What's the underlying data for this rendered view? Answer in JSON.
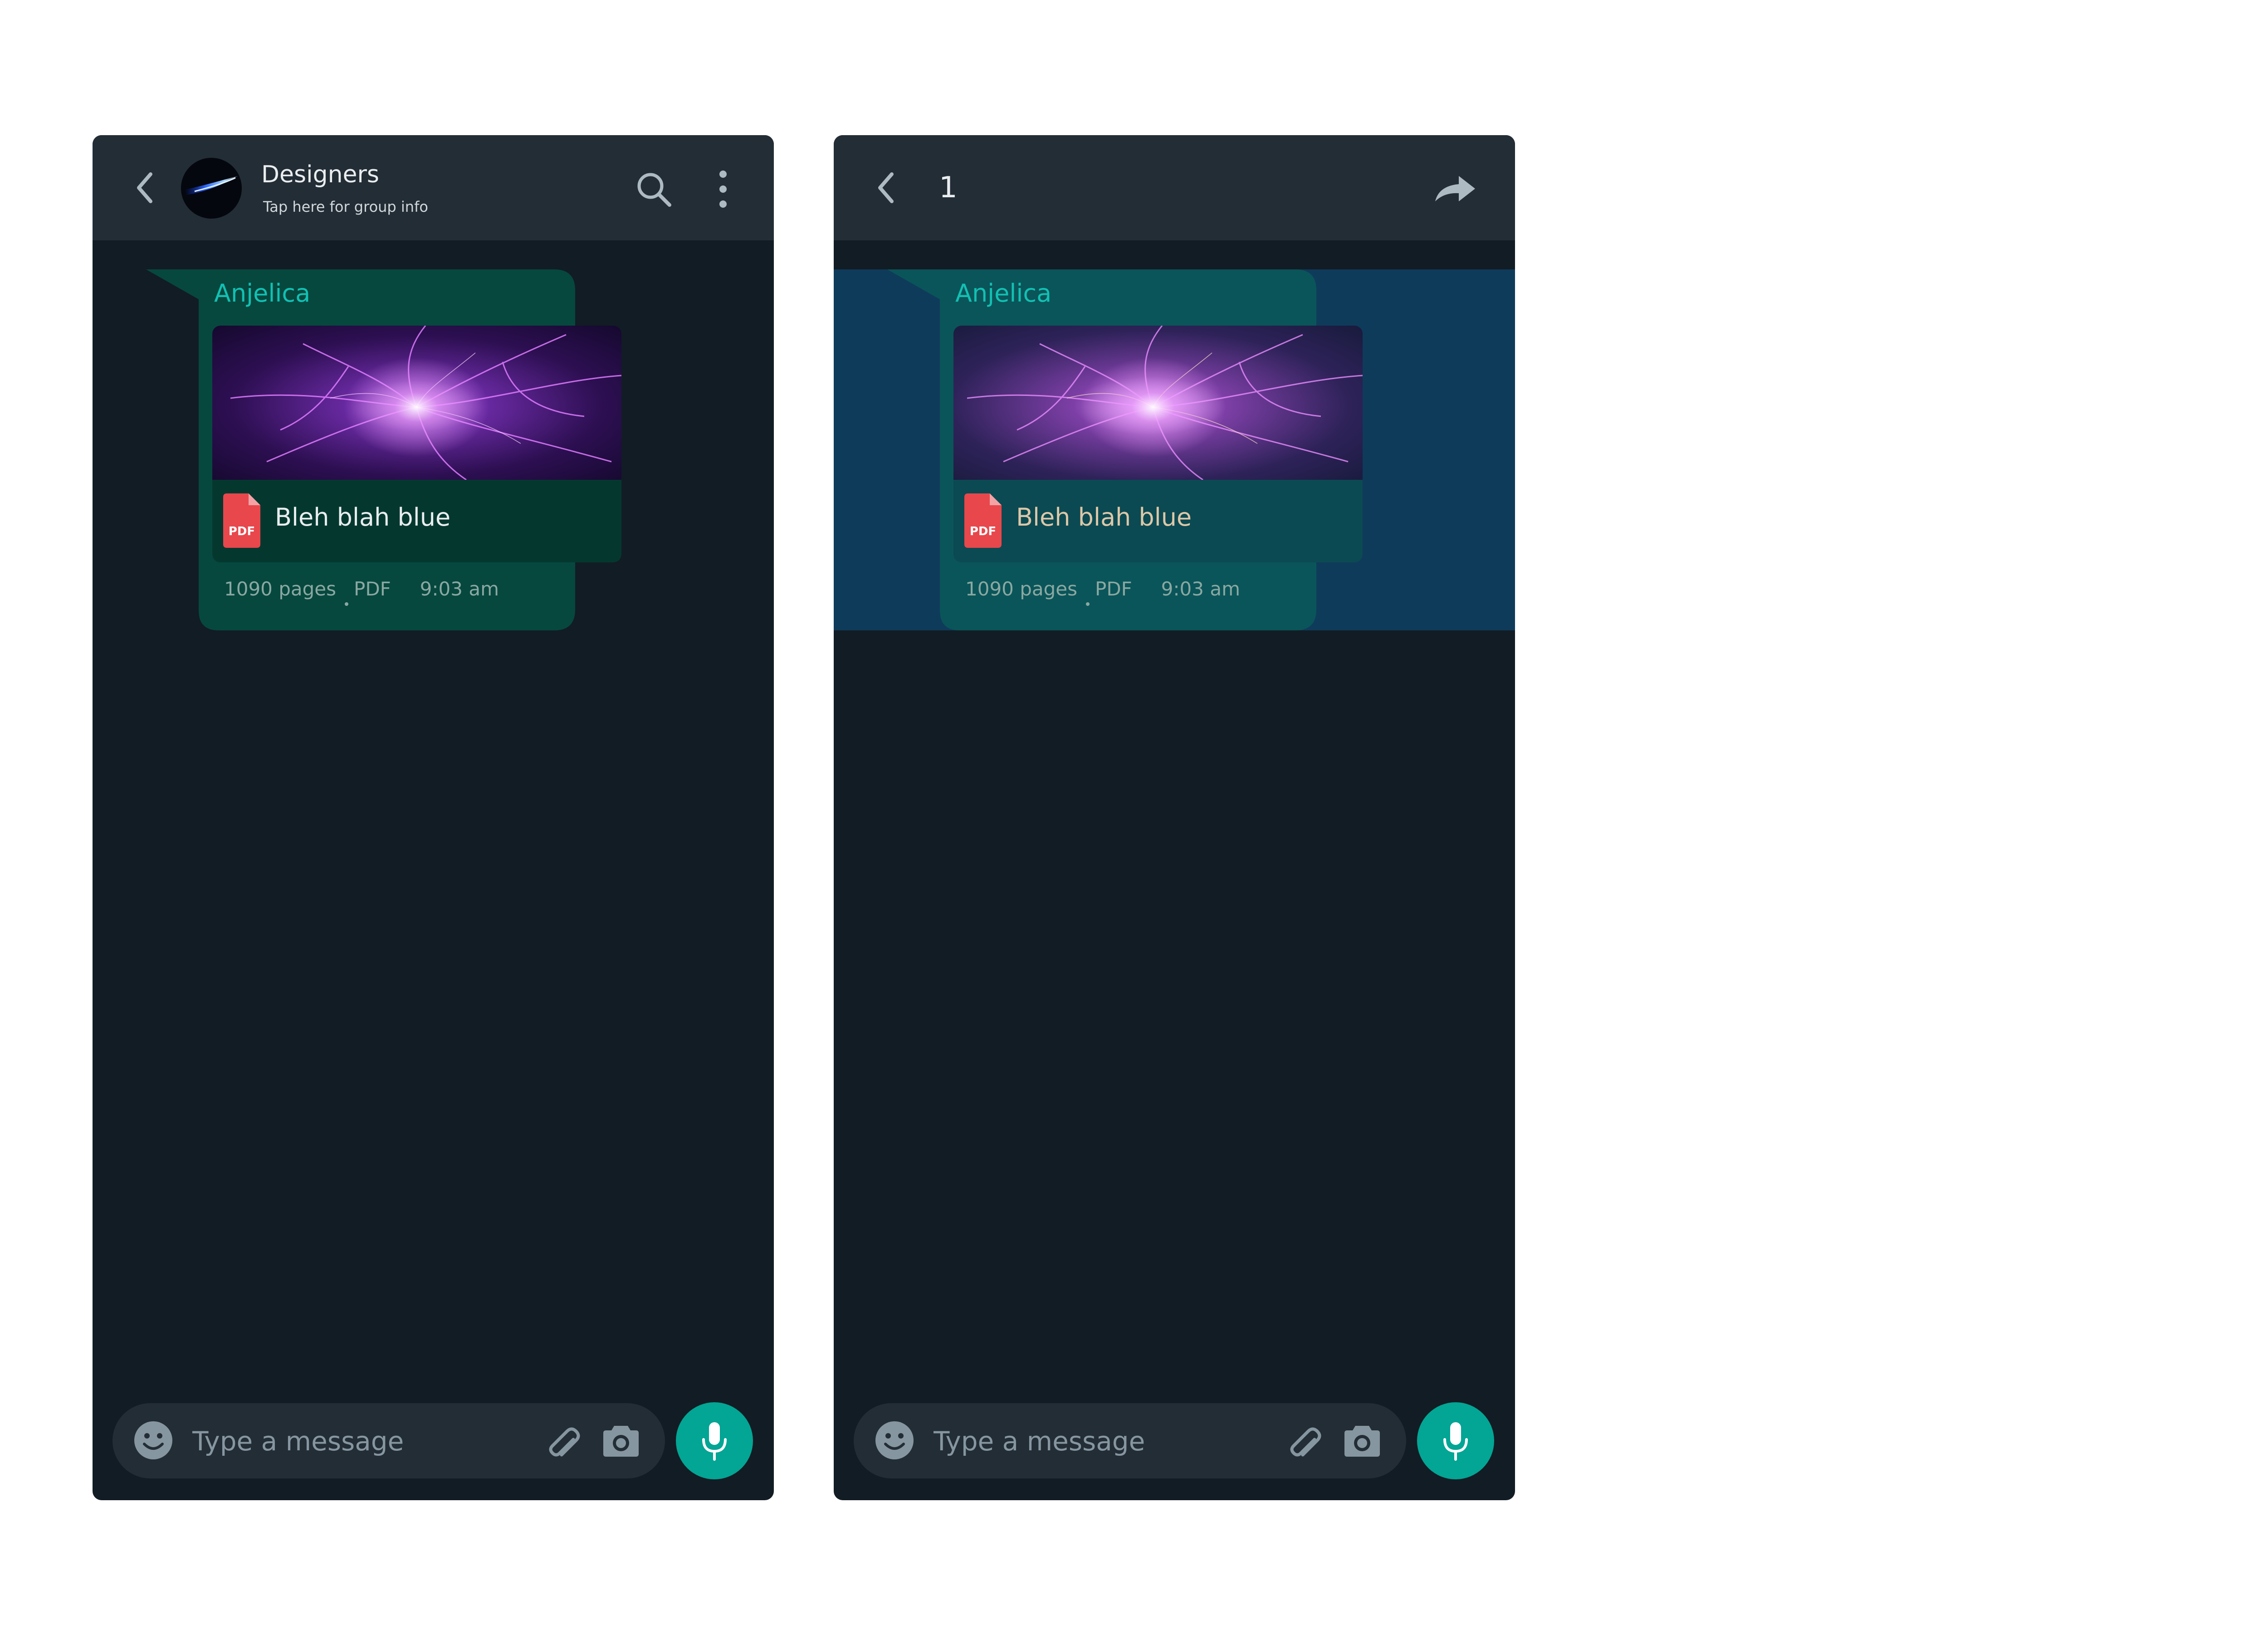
{
  "colors": {
    "background": "#121c24",
    "header": "#232d36",
    "bubble": "#06483e",
    "bubble_selected": "#0a5559",
    "selection_band": "#0f3b5b",
    "sender_name": "#12c0b3",
    "accent_mic": "#03a594",
    "pdf_icon": "#e8474c",
    "icon_gray": "#8696a0"
  },
  "left_screen": {
    "header": {
      "back_icon": "chevron-left-icon",
      "avatar": "group-avatar",
      "title": "Designers",
      "subtitle": "Tap here for group info",
      "search_icon": "search-icon",
      "menu_icon": "more-vertical-icon"
    },
    "message": {
      "sender": "Anjelica",
      "document_name": "Bleh blah blue",
      "file_badge": "PDF",
      "pages": "1090 pages",
      "extension": "PDF",
      "time": "9:03 am"
    },
    "composer": {
      "placeholder": "Type a message",
      "emoji_icon": "emoji-icon",
      "attach_icon": "paperclip-icon",
      "camera_icon": "camera-icon",
      "mic_icon": "mic-icon"
    }
  },
  "right_screen": {
    "header": {
      "back_icon": "chevron-left-icon",
      "selected_count": "1",
      "forward_icon": "forward-icon"
    },
    "message": {
      "sender": "Anjelica",
      "document_name": "Bleh blah blue",
      "file_badge": "PDF",
      "pages": "1090 pages",
      "extension": "PDF",
      "time": "9:03 am",
      "selected": true
    },
    "composer": {
      "placeholder": "Type a message",
      "emoji_icon": "emoji-icon",
      "attach_icon": "paperclip-icon",
      "camera_icon": "camera-icon",
      "mic_icon": "mic-icon"
    }
  }
}
